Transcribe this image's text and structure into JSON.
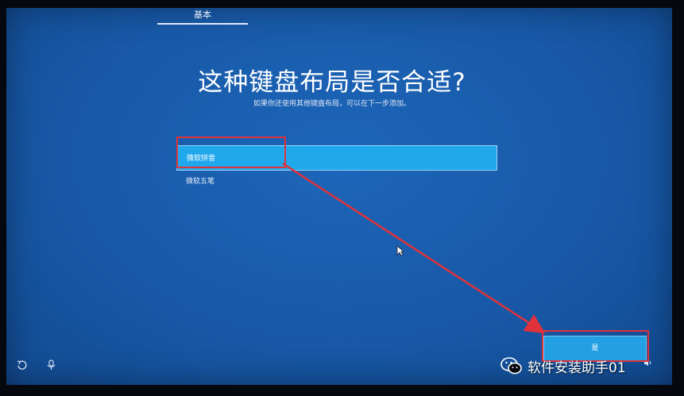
{
  "header": {
    "tab_label": "基本"
  },
  "main": {
    "title": "这种键盘布局是否合适?",
    "subtitle": "如果你还使用其他键盘布局，可以在下一步添加。",
    "layouts": [
      {
        "label": "微软拼音",
        "selected": true
      },
      {
        "label": "微软五笔",
        "selected": false
      }
    ]
  },
  "footer": {
    "yes_label": "是"
  },
  "watermark": {
    "text": "软件安装助手01"
  },
  "icons": {
    "back": "back-icon",
    "accessibility": "ease-of-access-icon",
    "volume": "volume-icon",
    "cursor": "mouse-cursor-icon",
    "wechat": "wechat-logo-icon"
  },
  "colors": {
    "background": "#1859a8",
    "selection": "#20a8ec",
    "button": "#23a0e4",
    "annotation": "#e0323a"
  }
}
